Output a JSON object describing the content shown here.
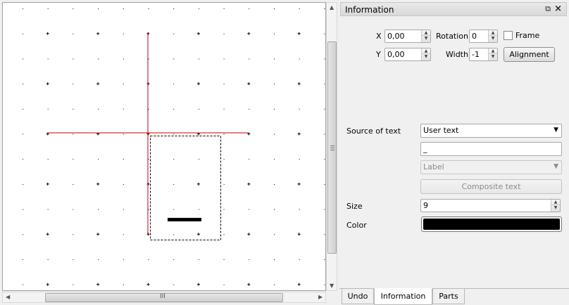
{
  "canvas": {
    "grid": {
      "dot_color": "#000000",
      "line_color": "#cc0000",
      "selection_color": "#000000"
    }
  },
  "dock": {
    "title": "Information",
    "float_icon": "restore-icon",
    "close_icon": "close-icon"
  },
  "position": {
    "x_label": "X",
    "x_value": "0,00",
    "y_label": "Y",
    "y_value": "0,00"
  },
  "rotation": {
    "label": "Rotation",
    "value": "0"
  },
  "width": {
    "label": "Width",
    "value": "-1"
  },
  "frame": {
    "label": "Frame",
    "checked": false
  },
  "alignment_button": "Alignment",
  "source_of_text": {
    "label": "Source of text",
    "selected": "User text"
  },
  "text_value": "_",
  "label_combo": "Label",
  "composite_button": "Composite text",
  "size": {
    "label": "Size",
    "value": "9"
  },
  "color": {
    "label": "Color",
    "value": "#000000"
  },
  "tabs": [
    {
      "label": "Undo",
      "active": false
    },
    {
      "label": "Information",
      "active": true
    },
    {
      "label": "Parts",
      "active": false
    }
  ],
  "hscroll_grip": "III"
}
